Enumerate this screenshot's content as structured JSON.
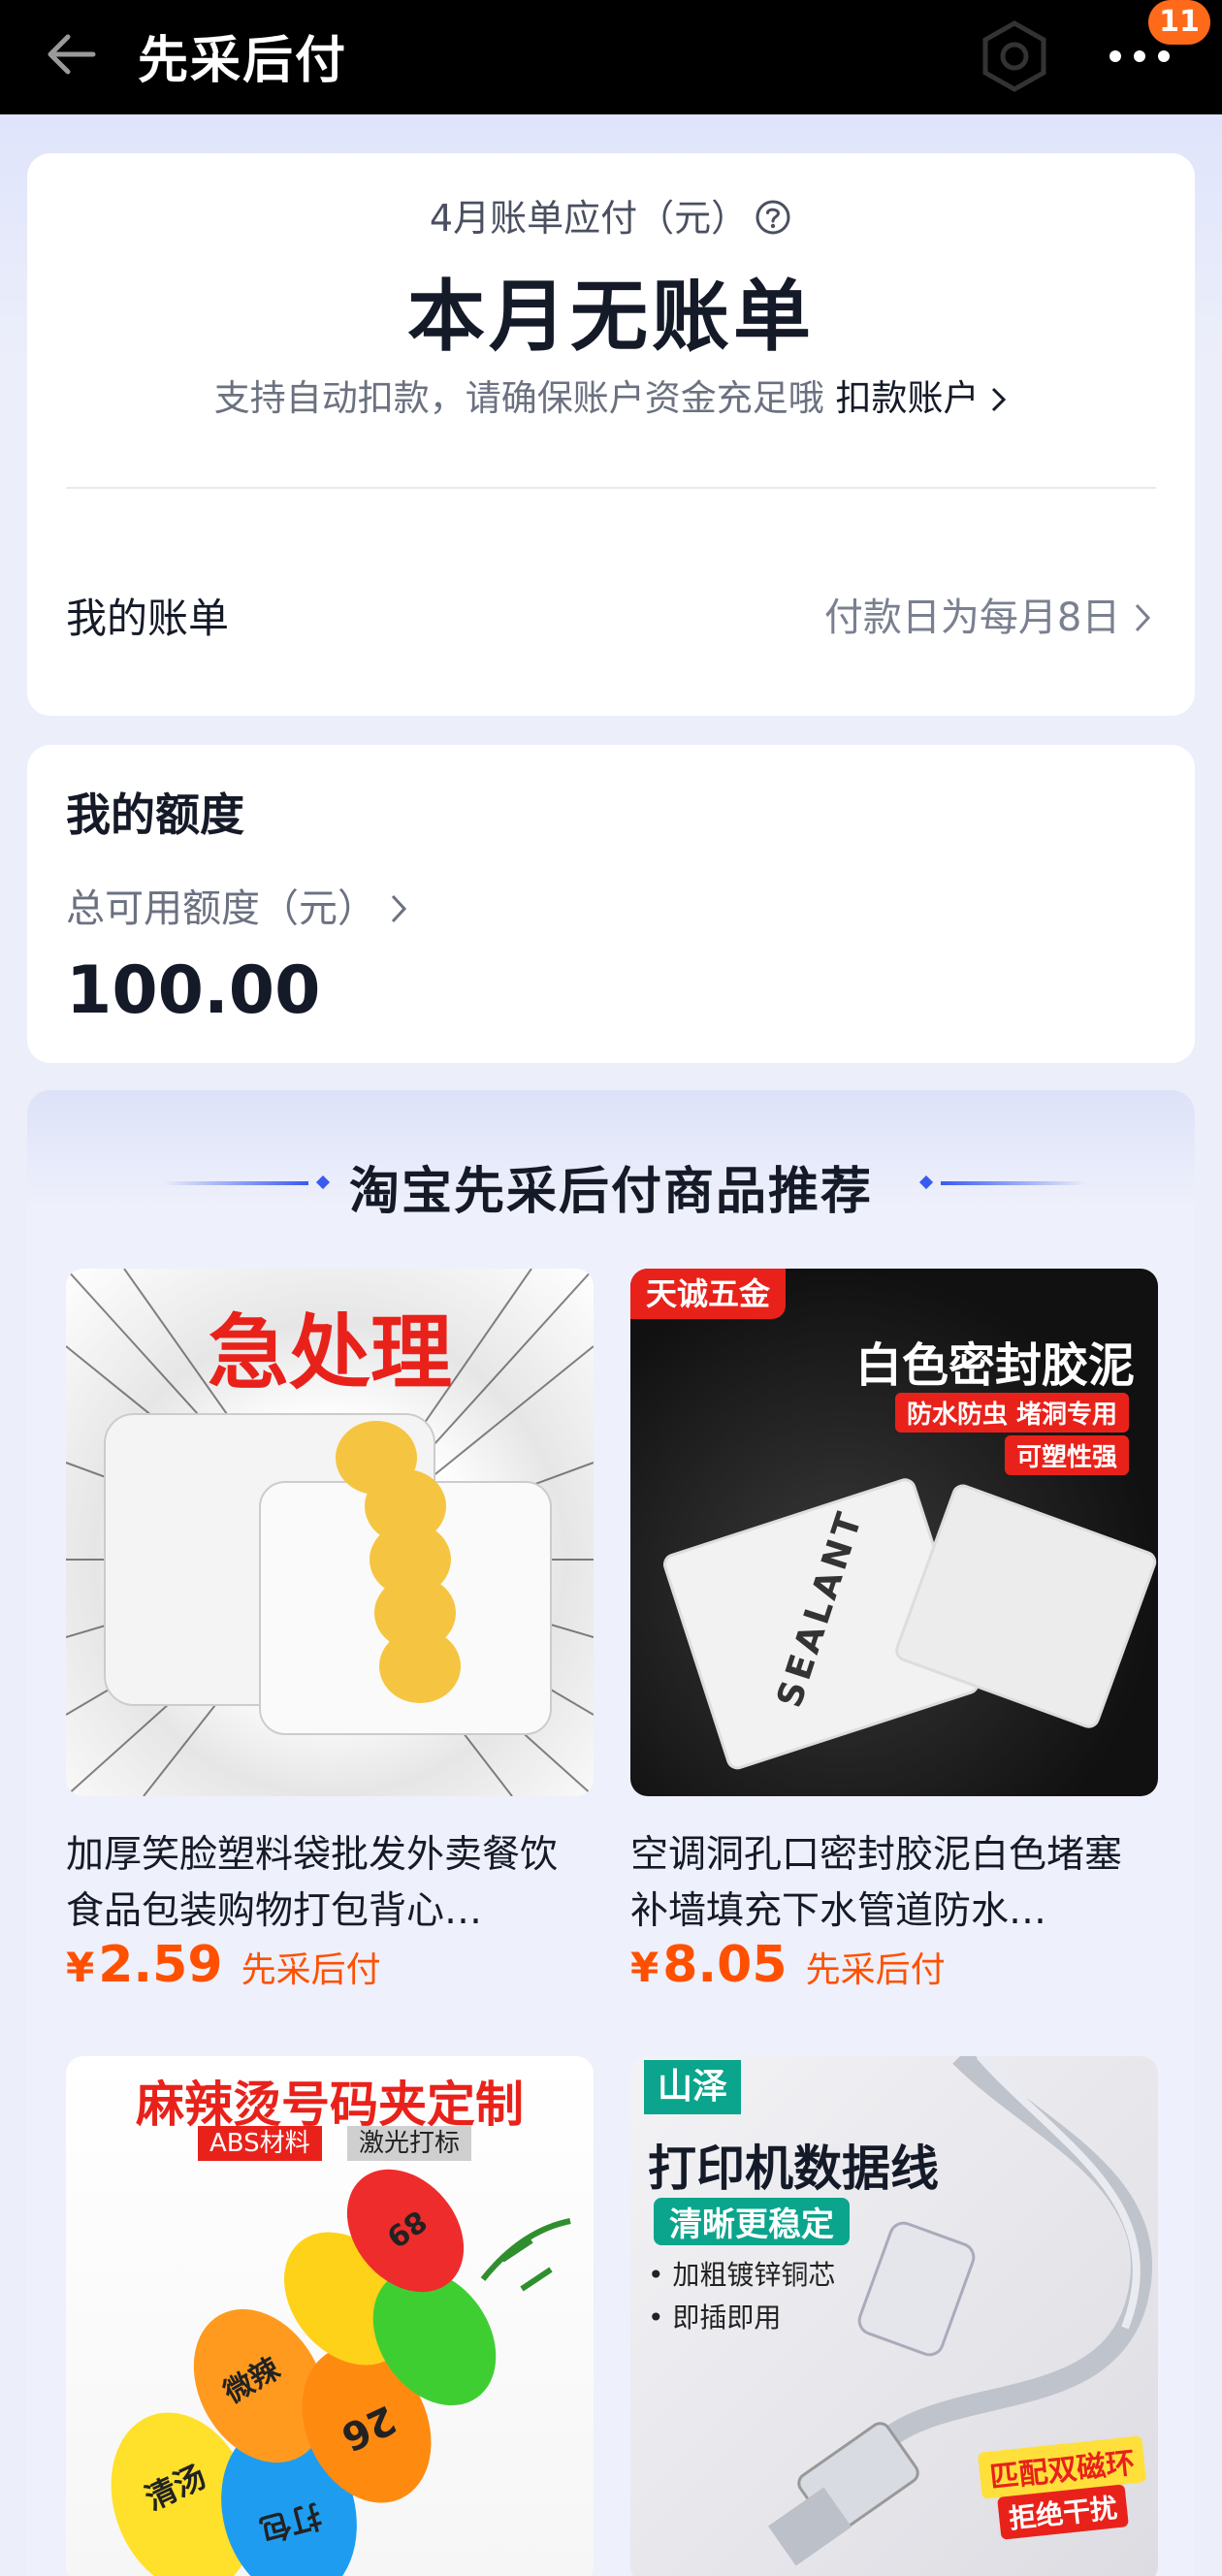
{
  "header": {
    "title": "先采后付",
    "badge_count": "11"
  },
  "bill": {
    "label": "4月账单应付（元）",
    "main": "本月无账单",
    "sub_text": "支持自动扣款，请确保账户资金充足哦",
    "account_link": "扣款账户",
    "my_bill_label": "我的账单",
    "due_text": "付款日为每月8日"
  },
  "quota": {
    "title": "我的额度",
    "label": "总可用额度（元）",
    "value": "100.00"
  },
  "recommend": {
    "title": "淘宝先采后付商品推荐",
    "products": [
      {
        "name": "加厚笑脸塑料袋批发外卖餐饮食品包装购物打包背心…",
        "yen": "¥",
        "price": "2.59",
        "tag": "先采后付",
        "img_text": "急处理"
      },
      {
        "name": "空调洞孔口密封胶泥白色堵塞补墙填充下水管道防水…",
        "yen": "¥",
        "price": "8.05",
        "tag": "先采后付",
        "img_brand": "天诚五金",
        "img_text": "白色密封胶泥",
        "img_tag1": "防水防虫 堵洞专用",
        "img_tag2": "可塑性强",
        "img_pack": "SEALANT"
      },
      {
        "img_text": "麻辣烫号码夹定制",
        "img_tag1": "ABS材料",
        "img_tag2": "激光打标",
        "clip_labels": [
          "清汤",
          "微辣",
          "26",
          "打包",
          "89"
        ]
      },
      {
        "img_brand": "山泽",
        "img_text": "打印机数据线",
        "img_tag1": "清晰更稳定",
        "img_bullet1": "• 加粗镀锌铜芯",
        "img_bullet2": "• 即插即用",
        "img_badge1": "匹配双磁环",
        "img_badge2": "拒绝干扰"
      }
    ]
  }
}
